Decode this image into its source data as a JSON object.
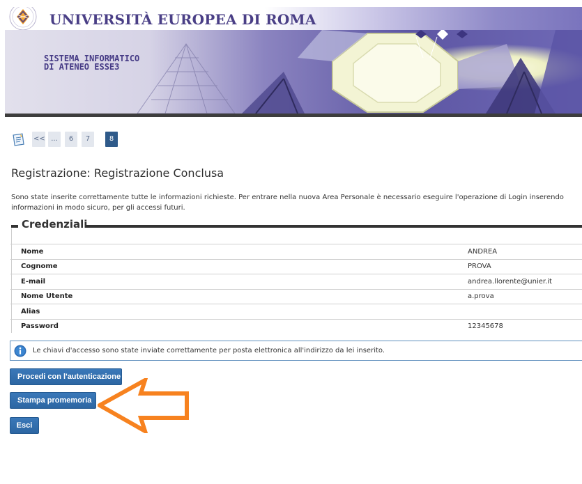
{
  "header": {
    "university_name": "UNIVERSITÀ EUROPEA DI ROMA",
    "system_title_line1": "SISTEMA INFORMATICO",
    "system_title_line2": "DI ATENEO ESSE3",
    "brand_color": "#4a3f86"
  },
  "pager": {
    "icon": "wizard-icon",
    "items": [
      "<<",
      "...",
      "6",
      "7",
      "8"
    ],
    "active": "8"
  },
  "page": {
    "title": "Registrazione: Registrazione Conclusa",
    "intro": "Sono state inserite correttamente tutte le informazioni richieste. Per entrare nella nuova Area Personale è necessario eseguire l'operazione di Login inserendo informazioni in modo sicuro, per gli accessi futuri."
  },
  "credentials": {
    "legend": "Credenziali",
    "rows": [
      {
        "label": "Nome",
        "value": "ANDREA"
      },
      {
        "label": "Cognome",
        "value": "PROVA"
      },
      {
        "label": "E-mail",
        "value": "andrea.llorente@unier.it"
      },
      {
        "label": "Nome Utente",
        "value": "a.prova"
      },
      {
        "label": "Alias",
        "value": ""
      },
      {
        "label": "Password",
        "value": "12345678"
      }
    ]
  },
  "info": {
    "icon": "info-icon",
    "text": "Le chiavi d'accesso sono state inviate correttamente per posta elettronica all'indirizzo da lei inserito."
  },
  "buttons": {
    "proceed": "Procedi con l'autenticazione",
    "print": "Stampa promemoria",
    "exit": "Esci",
    "color": "#2f6aa8"
  },
  "annotation": {
    "arrow_color": "#f7821f"
  }
}
